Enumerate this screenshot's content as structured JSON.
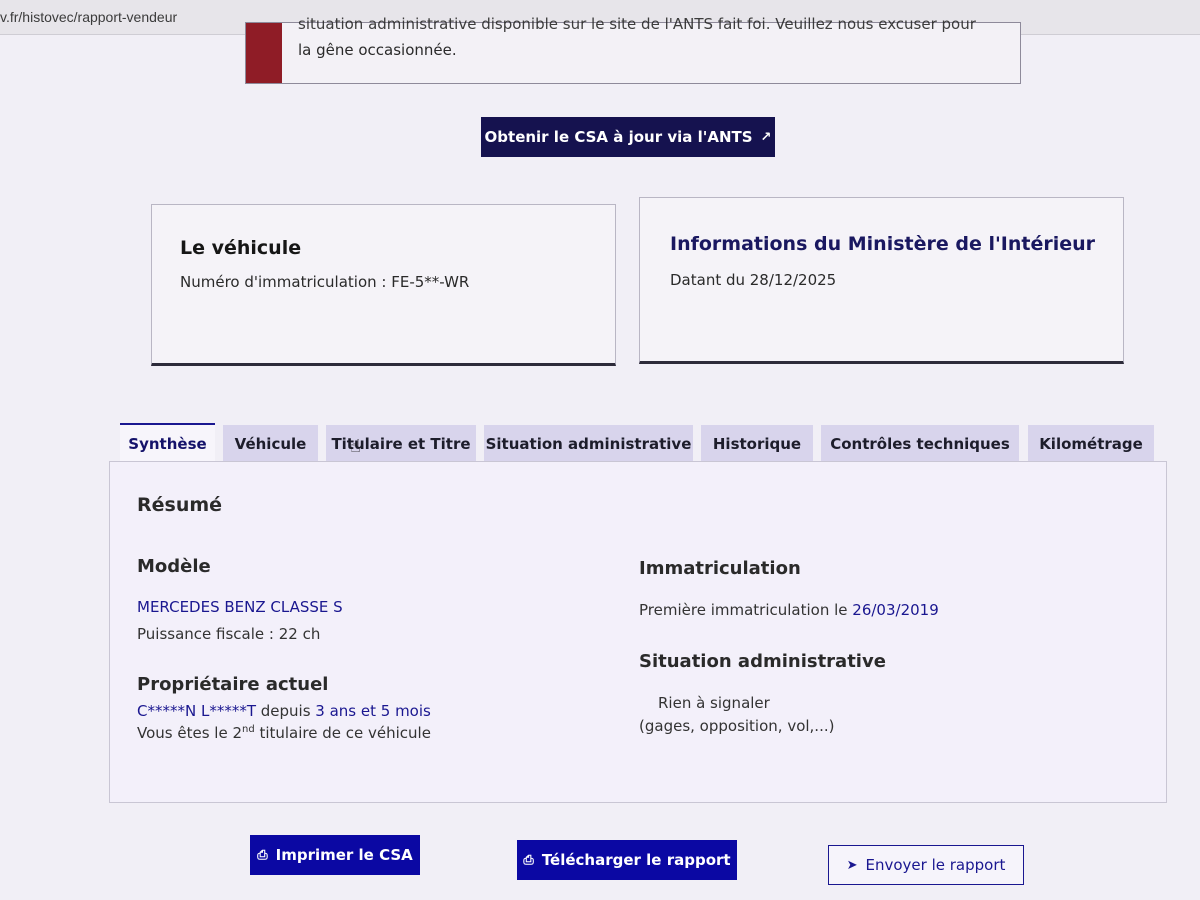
{
  "browser": {
    "url": "v.fr/histovec/rapport-vendeur"
  },
  "alert": {
    "line1": "situation administrative disponible sur le site de l'ANTS fait foi. Veuillez nous excuser pour",
    "line2": "la gêne occasionnée."
  },
  "ants_button": {
    "label": "Obtenir le CSA à jour via l'ANTS",
    "icon": "external-link-icon"
  },
  "vehicle_card": {
    "title": "Le véhicule",
    "plate_label": "Numéro d'immatriculation : FE-5**-WR"
  },
  "ministry_card": {
    "title": "Informations du Ministère de l'Intérieur",
    "date_text": "Datant du 28/12/2025"
  },
  "tabs": [
    {
      "label": "Synthèse",
      "active": true
    },
    {
      "label": "Véhicule"
    },
    {
      "label": "Titulaire et Titre"
    },
    {
      "label": "Situation administrative"
    },
    {
      "label": "Historique"
    },
    {
      "label": "Contrôles techniques"
    },
    {
      "label": "Kilométrage"
    }
  ],
  "summary": {
    "title": "Résumé",
    "model": {
      "heading": "Modèle",
      "name": "MERCEDES BENZ CLASSE S",
      "power": "Puissance fiscale : 22 ch"
    },
    "owner": {
      "heading": "Propriétaire actuel",
      "name": "C*****N L*****T",
      "since_prefix": " depuis ",
      "since": "3 ans et 5 mois",
      "rank_prefix": "Vous êtes le 2",
      "rank_sup": "nd",
      "rank_suffix": " titulaire de ce véhicule"
    },
    "registration": {
      "heading": "Immatriculation",
      "first_label": "Première immatriculation le ",
      "first_date": "26/03/2019"
    },
    "admin": {
      "heading": "Situation administrative",
      "status": "Rien à signaler",
      "detail": "(gages, opposition, vol,...)"
    }
  },
  "actions": {
    "print": "Imprimer le CSA",
    "download": "Télécharger le rapport",
    "send": "Envoyer le rapport"
  },
  "colors": {
    "primary": "#0b08a3",
    "dark": "#15124f",
    "alert": "#8f1c26"
  }
}
